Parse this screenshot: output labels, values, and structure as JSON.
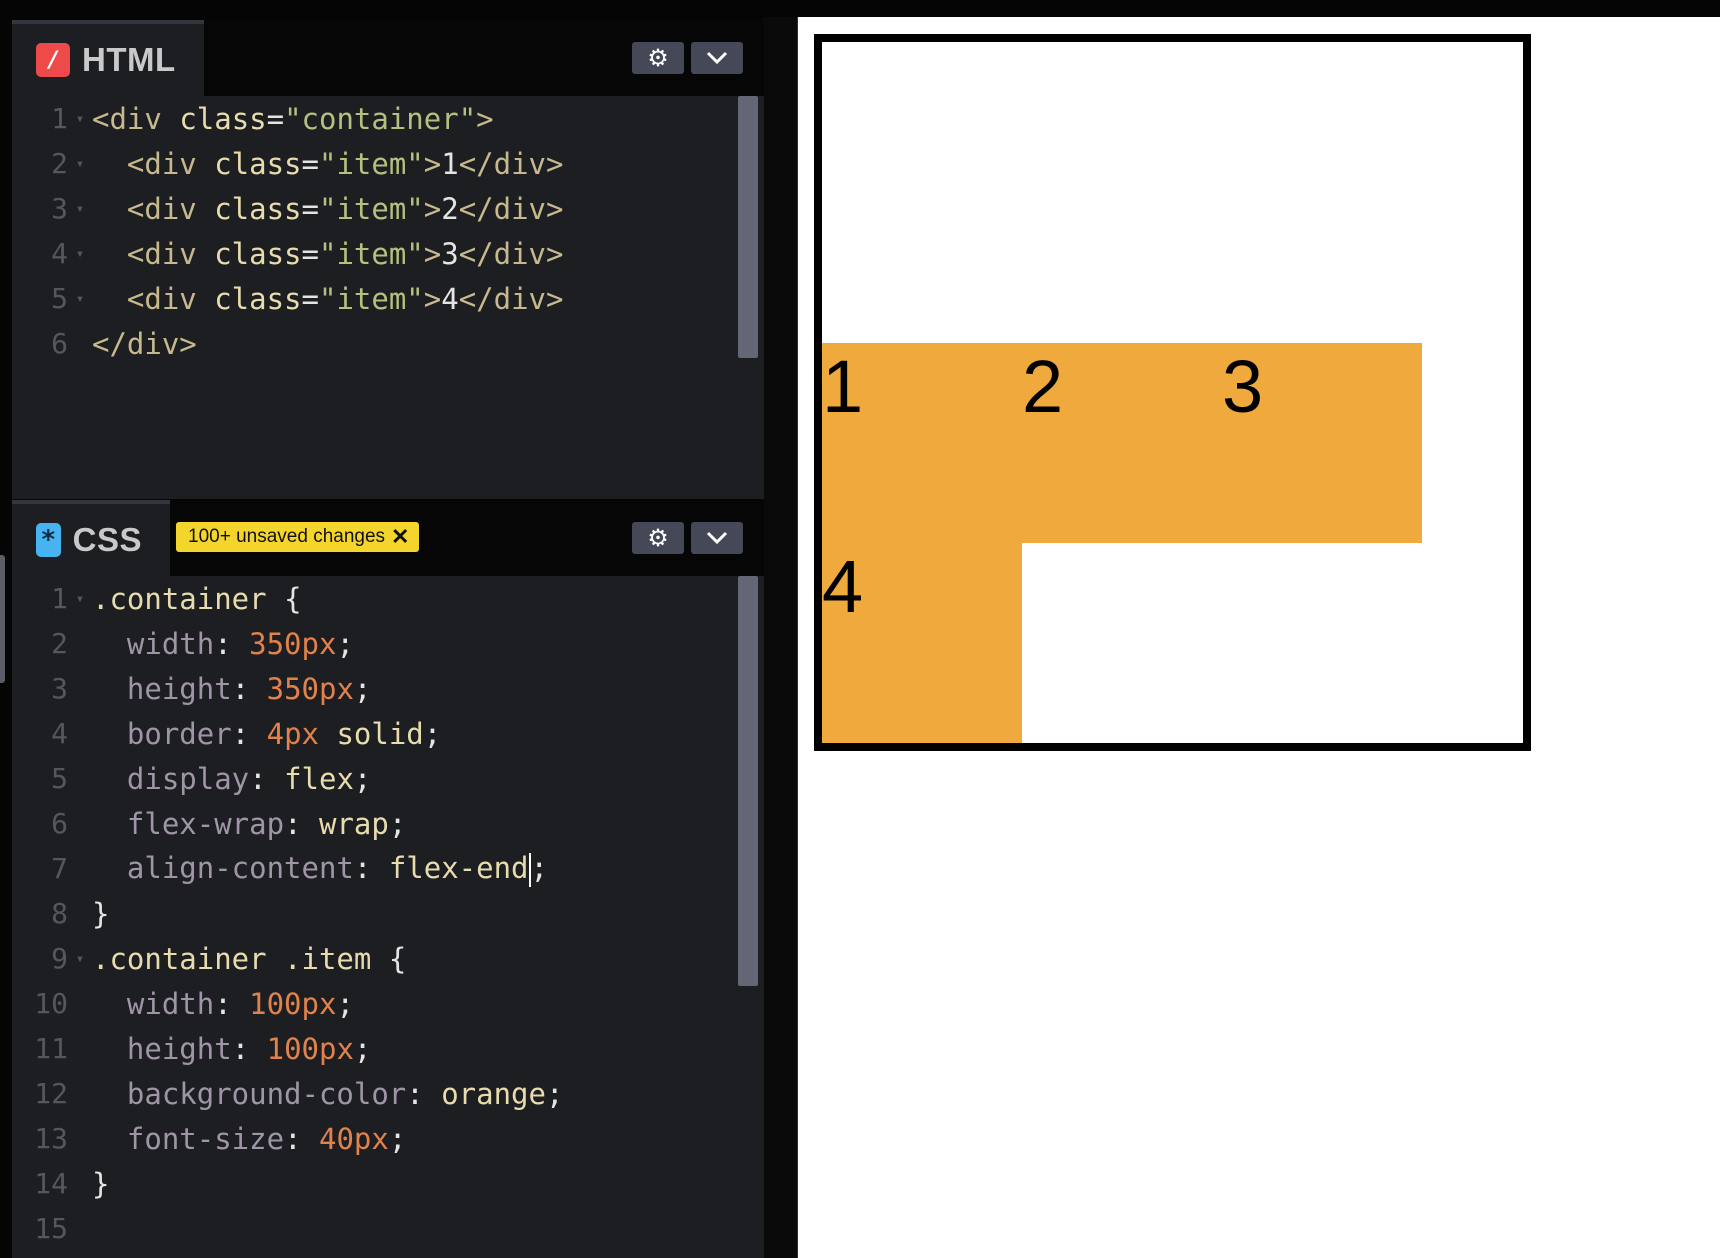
{
  "html_editor": {
    "tab_label": "HTML",
    "tab_icon": "/",
    "settings_icon": "gear-icon",
    "collapse_icon": "chevron-down-icon",
    "lines": [
      {
        "n": "1",
        "fold": true,
        "tokens": [
          [
            "tag",
            "<div "
          ],
          [
            "attr",
            "class"
          ],
          [
            "punct",
            "="
          ],
          [
            "str",
            "\"container\""
          ],
          [
            "tag",
            ">"
          ]
        ]
      },
      {
        "n": "2",
        "fold": true,
        "tokens": [
          [
            "tag",
            "  <div "
          ],
          [
            "attr",
            "class"
          ],
          [
            "punct",
            "="
          ],
          [
            "str",
            "\"item\""
          ],
          [
            "tag",
            ">"
          ],
          [
            "punct",
            "1"
          ],
          [
            "tag",
            "</div>"
          ]
        ]
      },
      {
        "n": "3",
        "fold": true,
        "tokens": [
          [
            "tag",
            "  <div "
          ],
          [
            "attr",
            "class"
          ],
          [
            "punct",
            "="
          ],
          [
            "str",
            "\"item\""
          ],
          [
            "tag",
            ">"
          ],
          [
            "punct",
            "2"
          ],
          [
            "tag",
            "</div>"
          ]
        ]
      },
      {
        "n": "4",
        "fold": true,
        "tokens": [
          [
            "tag",
            "  <div "
          ],
          [
            "attr",
            "class"
          ],
          [
            "punct",
            "="
          ],
          [
            "str",
            "\"item\""
          ],
          [
            "tag",
            ">"
          ],
          [
            "punct",
            "3"
          ],
          [
            "tag",
            "</div>"
          ]
        ]
      },
      {
        "n": "5",
        "fold": true,
        "tokens": [
          [
            "tag",
            "  <div "
          ],
          [
            "attr",
            "class"
          ],
          [
            "punct",
            "="
          ],
          [
            "str",
            "\"item\""
          ],
          [
            "tag",
            ">"
          ],
          [
            "punct",
            "4"
          ],
          [
            "tag",
            "</div>"
          ]
        ]
      },
      {
        "n": "6",
        "fold": false,
        "tokens": [
          [
            "tag",
            "</div>"
          ]
        ]
      }
    ]
  },
  "css_editor": {
    "tab_label": "CSS",
    "tab_icon": "*",
    "badge_text": "100+ unsaved changes",
    "badge_close": "✕",
    "settings_icon": "gear-icon",
    "collapse_icon": "chevron-down-icon",
    "lines": [
      {
        "n": "1",
        "fold": true,
        "tokens": [
          [
            "sel",
            ".container"
          ],
          [
            "punct",
            " {"
          ]
        ]
      },
      {
        "n": "2",
        "fold": false,
        "tokens": [
          [
            "prop",
            "  width"
          ],
          [
            "punct",
            ": "
          ],
          [
            "num",
            "350px"
          ],
          [
            "punct",
            ";"
          ]
        ]
      },
      {
        "n": "3",
        "fold": false,
        "tokens": [
          [
            "prop",
            "  height"
          ],
          [
            "punct",
            ": "
          ],
          [
            "num",
            "350px"
          ],
          [
            "punct",
            ";"
          ]
        ]
      },
      {
        "n": "4",
        "fold": false,
        "tokens": [
          [
            "prop",
            "  border"
          ],
          [
            "punct",
            ": "
          ],
          [
            "num",
            "4px"
          ],
          [
            "val",
            " solid"
          ],
          [
            "punct",
            ";"
          ]
        ]
      },
      {
        "n": "5",
        "fold": false,
        "tokens": [
          [
            "prop",
            "  display"
          ],
          [
            "punct",
            ": "
          ],
          [
            "val",
            "flex"
          ],
          [
            "punct",
            ";"
          ]
        ]
      },
      {
        "n": "6",
        "fold": false,
        "tokens": [
          [
            "prop",
            "  flex-wrap"
          ],
          [
            "punct",
            ": "
          ],
          [
            "val",
            "wrap"
          ],
          [
            "punct",
            ";"
          ]
        ]
      },
      {
        "n": "7",
        "fold": false,
        "cursor": true,
        "tokens": [
          [
            "prop",
            "  align-content"
          ],
          [
            "punct",
            ": "
          ],
          [
            "val",
            "flex-end"
          ],
          [
            "cursor",
            ""
          ],
          [
            "punct",
            ";"
          ]
        ]
      },
      {
        "n": "8",
        "fold": false,
        "tokens": [
          [
            "punct",
            "}"
          ]
        ]
      },
      {
        "n": "9",
        "fold": true,
        "tokens": [
          [
            "sel",
            ".container .item"
          ],
          [
            "punct",
            " {"
          ]
        ]
      },
      {
        "n": "10",
        "fold": false,
        "tokens": [
          [
            "prop",
            "  width"
          ],
          [
            "punct",
            ": "
          ],
          [
            "num",
            "100px"
          ],
          [
            "punct",
            ";"
          ]
        ]
      },
      {
        "n": "11",
        "fold": false,
        "tokens": [
          [
            "prop",
            "  height"
          ],
          [
            "punct",
            ": "
          ],
          [
            "num",
            "100px"
          ],
          [
            "punct",
            ";"
          ]
        ]
      },
      {
        "n": "12",
        "fold": false,
        "tokens": [
          [
            "prop",
            "  background-color"
          ],
          [
            "punct",
            ": "
          ],
          [
            "val",
            "orange"
          ],
          [
            "punct",
            ";"
          ]
        ]
      },
      {
        "n": "13",
        "fold": false,
        "tokens": [
          [
            "prop",
            "  font-size"
          ],
          [
            "punct",
            ": "
          ],
          [
            "num",
            "40px"
          ],
          [
            "punct",
            ";"
          ]
        ]
      },
      {
        "n": "14",
        "fold": false,
        "tokens": [
          [
            "punct",
            "}"
          ]
        ]
      },
      {
        "n": "15",
        "fold": false,
        "tokens": []
      }
    ]
  },
  "preview": {
    "items": [
      "1",
      "2",
      "3",
      "4"
    ],
    "item_color": "#f0a93c"
  }
}
